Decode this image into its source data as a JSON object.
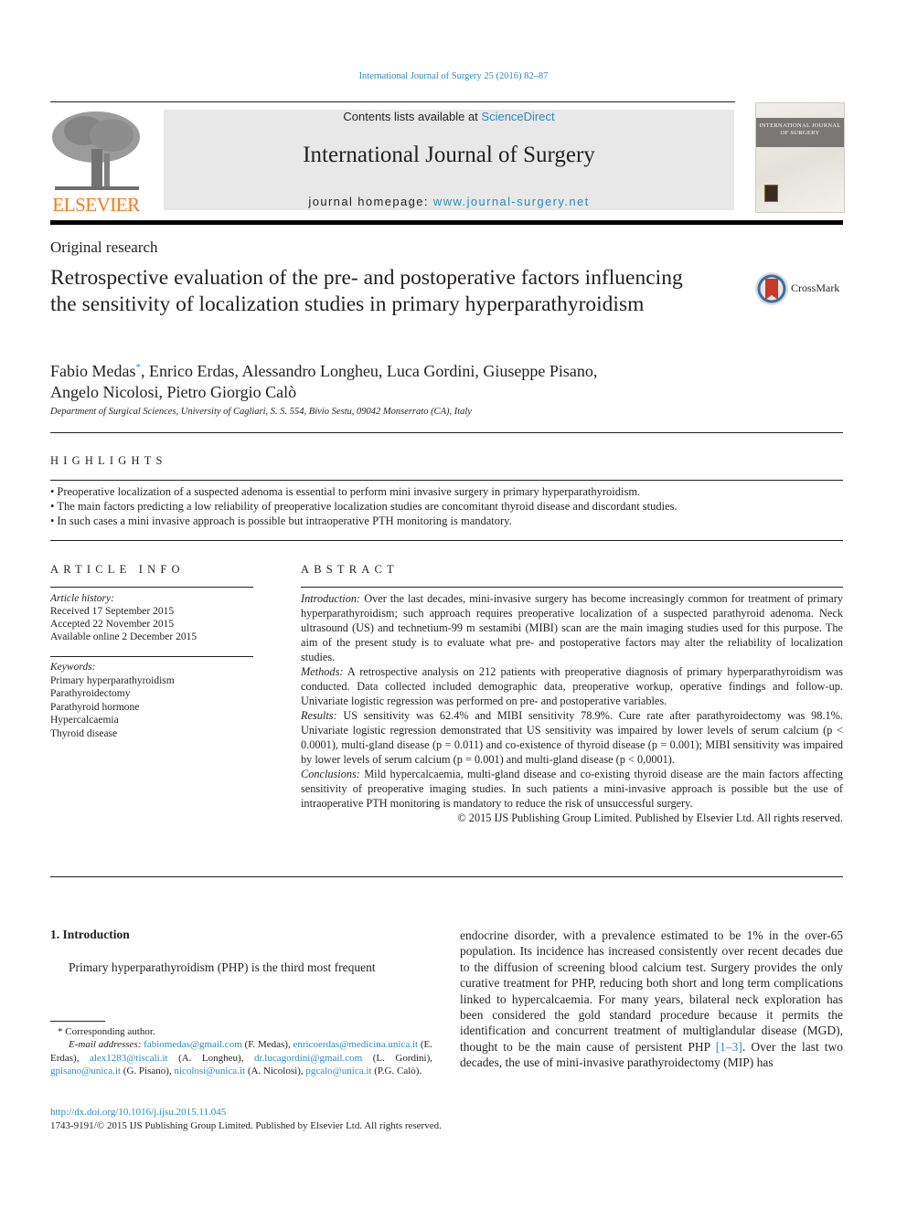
{
  "header": {
    "citation": "International Journal of Surgery 25 (2016) 82–87",
    "contents_prefix": "Contents lists available at ",
    "contents_link": "ScienceDirect",
    "journal_title": "International Journal of Surgery",
    "homepage_prefix": "journal homepage: ",
    "homepage_link": "www.journal-surgery.net",
    "publisher_logo": "ELSEVIER",
    "cover_title": "INTERNATIONAL JOURNAL OF SURGERY",
    "crossmark_label": "CrossMark"
  },
  "article": {
    "type": "Original research",
    "title": "Retrospective evaluation of the pre- and postoperative factors influencing the sensitivity of localization studies in primary hyperparathyroidism",
    "authors_line1_a": "Fabio Medas",
    "author_mark": "*",
    "authors_line1_b": ", Enrico Erdas, Alessandro Longheu, Luca Gordini, Giuseppe Pisano,",
    "authors_line2": "Angelo Nicolosi, Pietro Giorgio Calò",
    "affiliation": "Department of Surgical Sciences, University of Cagliari, S. S. 554, Bivio Sestu, 09042 Monserrato (CA), Italy"
  },
  "highlights": {
    "heading": "HIGHLIGHTS",
    "items": [
      "Preoperative localization of a suspected adenoma is essential to perform mini invasive surgery in primary hyperparathyroidism.",
      "The main factors predicting a low reliability of preoperative localization studies are concomitant thyroid disease and discordant studies.",
      "In such cases a mini invasive approach is possible but intraoperative PTH monitoring is mandatory."
    ]
  },
  "article_info": {
    "heading": "ARTICLE INFO",
    "history_label": "Article history:",
    "history": [
      "Received 17 September 2015",
      "Accepted 22 November 2015",
      "Available online 2 December 2015"
    ],
    "keywords_label": "Keywords:",
    "keywords": [
      "Primary hyperparathyroidism",
      "Parathyroidectomy",
      "Parathyroid hormone",
      "Hypercalcaemia",
      "Thyroid disease"
    ]
  },
  "abstract": {
    "heading": "ABSTRACT",
    "sections": [
      {
        "label": "Introduction:",
        "text": " Over the last decades, mini-invasive surgery has become increasingly common for treatment of primary hyperparathyroidism; such approach requires preoperative localization of a suspected parathyroid adenoma. Neck ultrasound (US) and technetium-99 m sestamibi (MIBI) scan are the main imaging studies used for this purpose. The aim of the present study is to evaluate what pre- and postoperative factors may alter the reliability of localization studies."
      },
      {
        "label": "Methods:",
        "text": " A retrospective analysis on 212 patients with preoperative diagnosis of primary hyperparathyroidism was conducted. Data collected included demographic data, preoperative workup, operative findings and follow-up. Univariate logistic regression was performed on pre- and postoperative variables."
      },
      {
        "label": "Results:",
        "text": " US sensitivity was 62.4% and MIBI sensitivity 78.9%. Cure rate after parathyroidectomy was 98.1%. Univariate logistic regression demonstrated that US sensitivity was impaired by lower levels of serum calcium (p < 0.0001), multi-gland disease (p = 0.011) and co-existence of thyroid disease (p = 0.001); MIBI sensitivity was impaired by lower levels of serum calcium (p = 0.001) and multi-gland disease (p < 0,0001)."
      },
      {
        "label": "Conclusions:",
        "text": " Mild hypercalcaemia, multi-gland disease and co-existing thyroid disease are the main factors affecting sensitivity of preoperative imaging studies. In such patients a mini-invasive approach is possible but the use of intraoperative PTH monitoring is mandatory to reduce the risk of unsuccessful surgery."
      }
    ],
    "copyright": "© 2015 IJS Publishing Group Limited. Published by Elsevier Ltd. All rights reserved."
  },
  "body": {
    "intro_heading": "1.  Introduction",
    "left_para": "Primary hyperparathyroidism (PHP) is the third most frequent",
    "right_para_a": "endocrine disorder, with a prevalence estimated to be 1% in the over-65 population. Its incidence has increased consistently over recent decades due to the diffusion of screening blood calcium test. Surgery provides the only curative treatment for PHP, reducing both short and long term complications linked to hypercalcaemia. For many years, bilateral neck exploration has been considered the gold standard procedure because it permits the identification and concurrent treatment of multiglandular disease (MGD), thought to be the main cause of persistent PHP ",
    "right_para_ref": "[1–3]",
    "right_para_b": ". Over the last two decades, the use of mini-invasive parathyroidectomy (MIP) has"
  },
  "footnote": {
    "corresponding": "* Corresponding author.",
    "email_label": "E-mail addresses:",
    "emails": [
      {
        "email": "fabiomedas@gmail.com",
        "name": " (F. Medas), "
      },
      {
        "email": "enricoerdas@medicina.unica.it",
        "name": " (E. Erdas), "
      },
      {
        "email": "alex1283@tiscali.it",
        "name": " (A. Longheu), "
      },
      {
        "email": "dr.lucagordini@gmail.com",
        "name": " (L. Gordini), "
      },
      {
        "email": "gpisano@unica.it",
        "name": " (G. Pisano), "
      },
      {
        "email": "nicolosi@unica.it",
        "name": " (A. Nicolosi), "
      },
      {
        "email": "pgcalo@unica.it",
        "name": " (P.G. Calò)."
      }
    ]
  },
  "footer": {
    "doi": "http://dx.doi.org/10.1016/j.ijsu.2015.11.045",
    "issn": "1743-9191/© 2015 IJS Publishing Group Limited. Published by Elsevier Ltd. All rights reserved."
  }
}
